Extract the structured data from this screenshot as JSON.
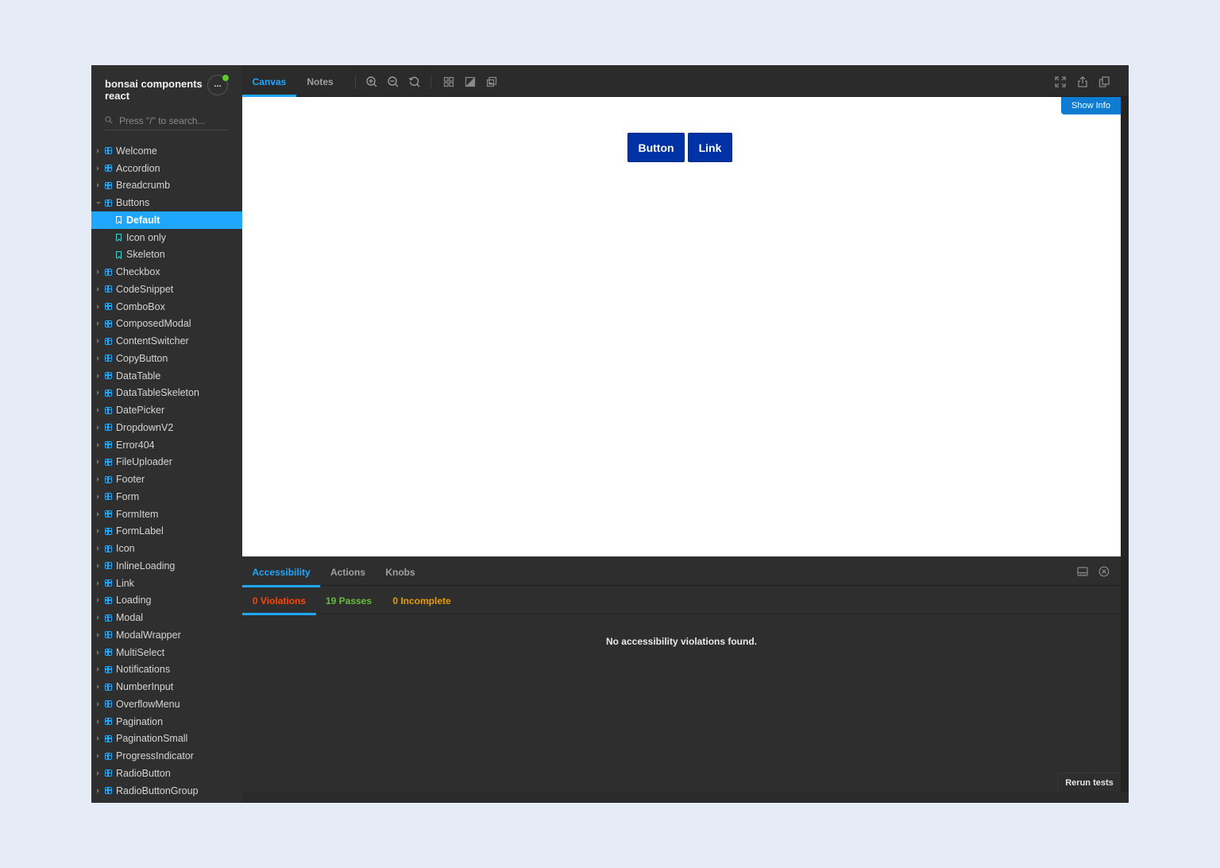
{
  "sidebar": {
    "title": "bonsai components react",
    "menu_label": "...",
    "status_color": "#5fc92e",
    "search_placeholder": "Press \"/\" to search...",
    "items": [
      {
        "label": "Welcome",
        "type": "component",
        "expanded": false
      },
      {
        "label": "Accordion",
        "type": "component",
        "expanded": false
      },
      {
        "label": "Breadcrumb",
        "type": "component",
        "expanded": false
      },
      {
        "label": "Buttons",
        "type": "component",
        "expanded": true
      },
      {
        "label": "Default",
        "type": "story",
        "selected": true
      },
      {
        "label": "Icon only",
        "type": "story"
      },
      {
        "label": "Skeleton",
        "type": "story"
      },
      {
        "label": "Checkbox",
        "type": "component",
        "expanded": false
      },
      {
        "label": "CodeSnippet",
        "type": "component",
        "expanded": false
      },
      {
        "label": "ComboBox",
        "type": "component",
        "expanded": false
      },
      {
        "label": "ComposedModal",
        "type": "component",
        "expanded": false
      },
      {
        "label": "ContentSwitcher",
        "type": "component",
        "expanded": false
      },
      {
        "label": "CopyButton",
        "type": "component",
        "expanded": false
      },
      {
        "label": "DataTable",
        "type": "component",
        "expanded": false
      },
      {
        "label": "DataTableSkeleton",
        "type": "component",
        "expanded": false
      },
      {
        "label": "DatePicker",
        "type": "component",
        "expanded": false
      },
      {
        "label": "DropdownV2",
        "type": "component",
        "expanded": false
      },
      {
        "label": "Error404",
        "type": "component",
        "expanded": false
      },
      {
        "label": "FileUploader",
        "type": "component",
        "expanded": false
      },
      {
        "label": "Footer",
        "type": "component",
        "expanded": false
      },
      {
        "label": "Form",
        "type": "component",
        "expanded": false
      },
      {
        "label": "FormItem",
        "type": "component",
        "expanded": false
      },
      {
        "label": "FormLabel",
        "type": "component",
        "expanded": false
      },
      {
        "label": "Icon",
        "type": "component",
        "expanded": false
      },
      {
        "label": "InlineLoading",
        "type": "component",
        "expanded": false
      },
      {
        "label": "Link",
        "type": "component",
        "expanded": false
      },
      {
        "label": "Loading",
        "type": "component",
        "expanded": false
      },
      {
        "label": "Modal",
        "type": "component",
        "expanded": false
      },
      {
        "label": "ModalWrapper",
        "type": "component",
        "expanded": false
      },
      {
        "label": "MultiSelect",
        "type": "component",
        "expanded": false
      },
      {
        "label": "Notifications",
        "type": "component",
        "expanded": false
      },
      {
        "label": "NumberInput",
        "type": "component",
        "expanded": false
      },
      {
        "label": "OverflowMenu",
        "type": "component",
        "expanded": false
      },
      {
        "label": "Pagination",
        "type": "component",
        "expanded": false
      },
      {
        "label": "PaginationSmall",
        "type": "component",
        "expanded": false
      },
      {
        "label": "ProgressIndicator",
        "type": "component",
        "expanded": false
      },
      {
        "label": "RadioButton",
        "type": "component",
        "expanded": false
      },
      {
        "label": "RadioButtonGroup",
        "type": "component",
        "expanded": false
      }
    ]
  },
  "toolbar": {
    "tabs": [
      {
        "label": "Canvas",
        "active": true
      },
      {
        "label": "Notes",
        "active": false
      }
    ],
    "tools": [
      "zoom-in-icon",
      "zoom-out-icon",
      "zoom-reset-icon",
      "grid-icon",
      "background-icon",
      "outline-icon"
    ],
    "right_tools": [
      "fullscreen-icon",
      "share-icon",
      "copy-icon"
    ]
  },
  "canvas": {
    "show_info_label": "Show Info",
    "buttons": [
      {
        "label": "Button"
      },
      {
        "label": "Link"
      }
    ],
    "button_color": "#0032a5"
  },
  "addons": {
    "tabs": [
      {
        "label": "Accessibility",
        "active": true
      },
      {
        "label": "Actions",
        "active": false
      },
      {
        "label": "Knobs",
        "active": false
      }
    ],
    "a11y_tabs": [
      {
        "label": "0 Violations",
        "color": "#ff4400",
        "active": true
      },
      {
        "label": "19 Passes",
        "color": "#66bf3c",
        "active": false
      },
      {
        "label": "0 Incomplete",
        "color": "#e69d00",
        "active": false
      }
    ],
    "message": "No accessibility violations found.",
    "rerun_label": "Rerun tests"
  },
  "colors": {
    "accent": "#1ea7fd"
  }
}
